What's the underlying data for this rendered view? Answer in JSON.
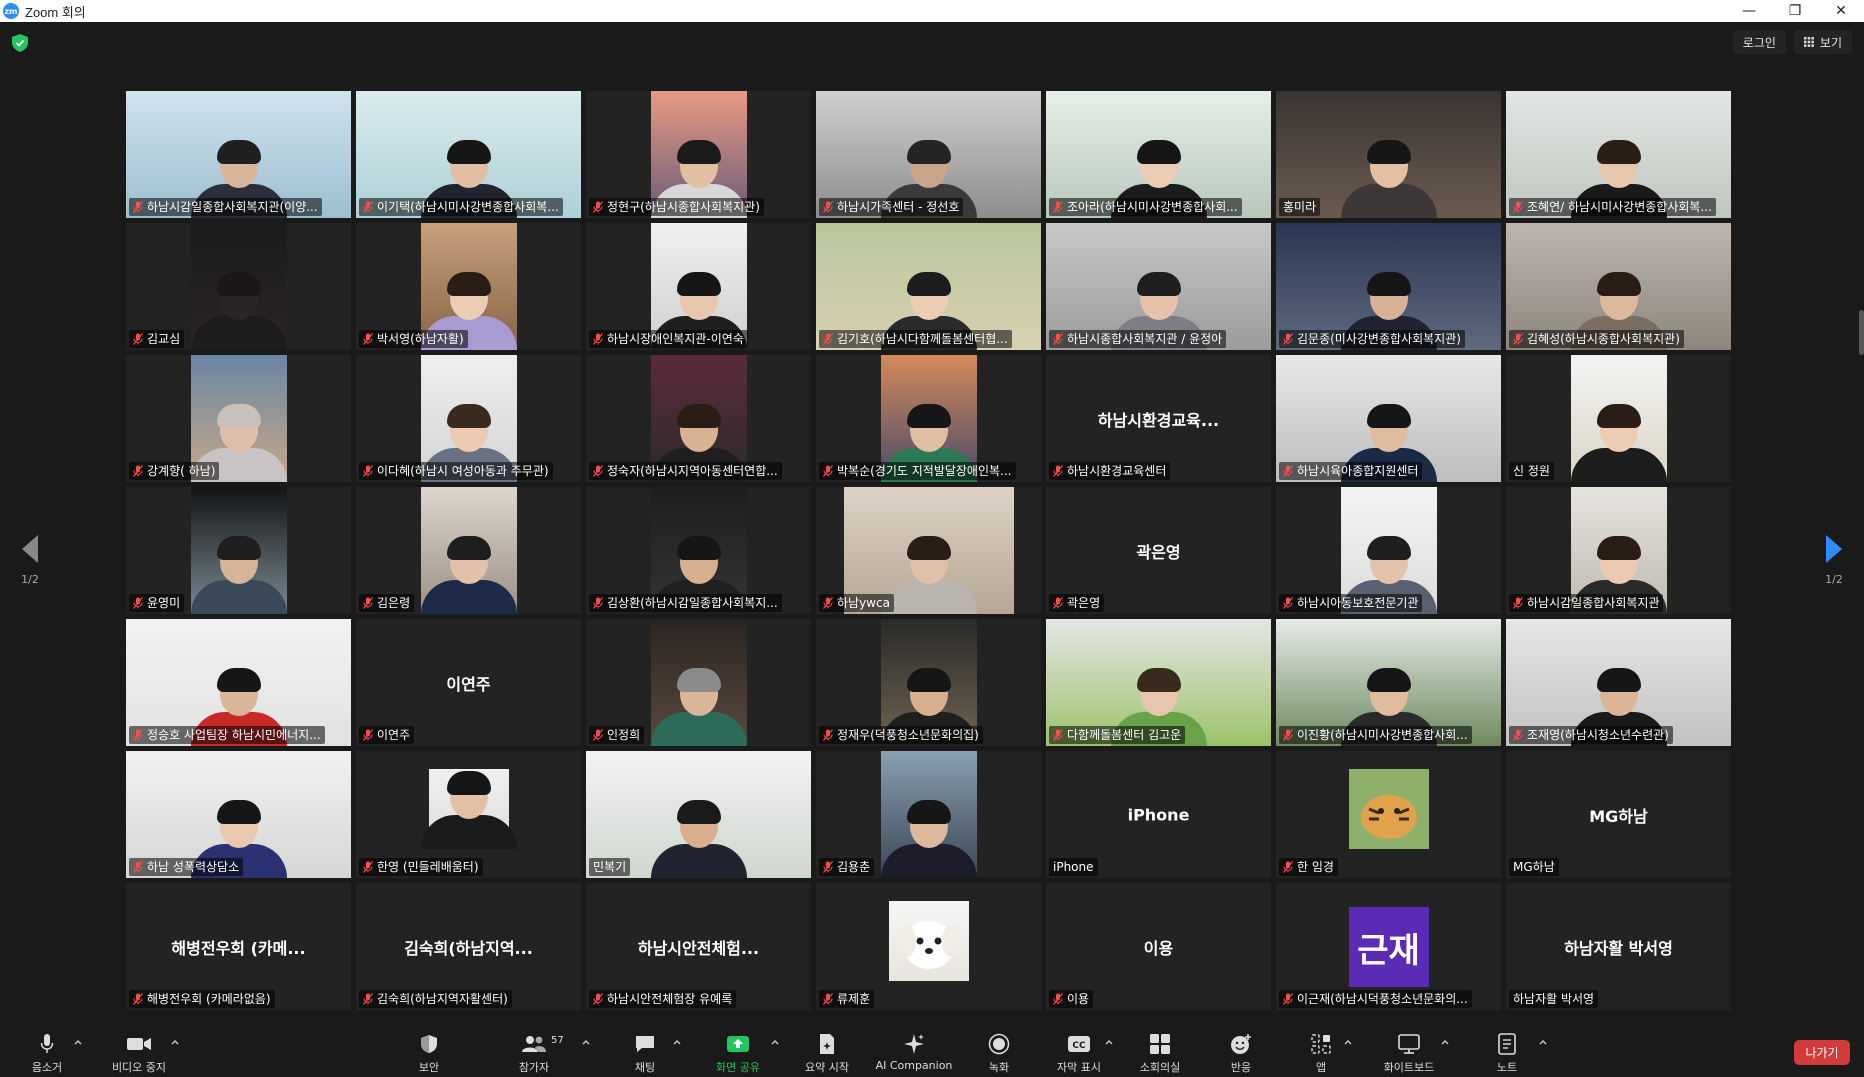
{
  "window": {
    "title": "Zoom 회의",
    "logo": "zm",
    "minimize": "—",
    "restore": "❐",
    "close": "✕"
  },
  "topbar": {
    "login": "로그인",
    "view": "보기"
  },
  "pager": {
    "left": "1/2",
    "right": "1/2"
  },
  "participants": [
    {
      "label": "하남시감일종합사회복지관(이양...",
      "muted": true,
      "video": "full",
      "c1": "#cfe3ee",
      "c2": "#9dbfcf",
      "skin": "#d9b59a",
      "hair": "#1f1f1f",
      "shirt": "#2a2f3a"
    },
    {
      "label": "이기택(하남시미사강변종합사회복...",
      "muted": true,
      "active": true,
      "video": "full",
      "c1": "#d8ecef",
      "c2": "#aed0d6",
      "skin": "#e0bea3",
      "hair": "#161616",
      "shirt": "#20242c"
    },
    {
      "label": "정현구(하남시종합사회복지관)",
      "muted": true,
      "video": "center",
      "c1": "#e89a83",
      "c2": "#6a5a78",
      "skin": "#e3bfa1",
      "hair": "#1a1a1a",
      "shirt": "#d8d8d8"
    },
    {
      "label": "하남시가족센터 - 정선호",
      "muted": true,
      "video": "full",
      "c1": "#cfcfcf",
      "c2": "#8d8d8d",
      "skin": "#c9a58c",
      "hair": "#242424",
      "shirt": "#3a3a3a"
    },
    {
      "label": "조아라(하남시미사강변종합사회...",
      "muted": true,
      "video": "full",
      "c1": "#e6efe8",
      "c2": "#b8c7bb",
      "skin": "#ebcdb5",
      "hair": "#161616",
      "shirt": "#1c1c1c"
    },
    {
      "label": "홍미라",
      "muted": false,
      "video": "full",
      "c1": "#3a3431",
      "c2": "#6a5b50",
      "skin": "#e3c0a4",
      "hair": "#161616",
      "shirt": "#3d3837"
    },
    {
      "label": "조혜연/ 하남시미사강변종합사회복...",
      "muted": true,
      "video": "full",
      "c1": "#e3e6e3",
      "c2": "#bfc6c0",
      "skin": "#e6c7ae",
      "hair": "#2a1e17",
      "shirt": "#1a1a1a"
    },
    {
      "label": "김교심",
      "muted": true,
      "video": "center",
      "c1": "#1c1a1b",
      "c2": "#2a2627",
      "skin": "#2b2525",
      "hair": "#1b1717",
      "shirt": "#1e1b1b"
    },
    {
      "label": "박서영(하남자활)",
      "muted": true,
      "video": "center",
      "c1": "#c9a07b",
      "c2": "#866446",
      "skin": "#ecccb5",
      "hair": "#2a1d15",
      "shirt": "#a99ad2"
    },
    {
      "label": "하남시장애인복지관-이연숙",
      "muted": true,
      "video": "center",
      "c1": "#f0f0f0",
      "c2": "#cfcfcf",
      "skin": "#e7c6ad",
      "hair": "#161616",
      "shirt": "#1f1f1f"
    },
    {
      "label": "김기호(하남시다함께돌봄센터협...",
      "muted": true,
      "video": "full",
      "c1": "#b9c79c",
      "c2": "#d8d0b2",
      "skin": "#ecccb3",
      "hair": "#1d1d1d",
      "shirt": "#2a2a2a"
    },
    {
      "label": "하남시종합사회복지관 / 윤정아",
      "muted": true,
      "video": "full",
      "c1": "#c8c8c8",
      "c2": "#9b9b9b",
      "skin": "#e4c3aa",
      "hair": "#1f1f1f",
      "shirt": "#7e7e86"
    },
    {
      "label": "김문종(미사강변종합사회복지관)",
      "muted": true,
      "video": "full",
      "c1": "#2a3552",
      "c2": "#5f6a7e",
      "skin": "#d8b196",
      "hair": "#161616",
      "shirt": "#1f2430"
    },
    {
      "label": "김혜성(하남시종합사회복지관)",
      "muted": true,
      "video": "full",
      "c1": "#bdb6ae",
      "c2": "#8e867d",
      "skin": "#dcb99d",
      "hair": "#2a1d15",
      "shirt": "#7a6e63"
    },
    {
      "label": "강계향( 하남)",
      "muted": true,
      "video": "center",
      "c1": "#6a86a6",
      "c2": "#c7a886",
      "skin": "#e0bfa8",
      "hair": "#c9c0bb",
      "shirt": "#c9c3c4"
    },
    {
      "label": "이다혜(하남시 여성아동과 주무관)",
      "muted": true,
      "video": "center",
      "c1": "#eeeeee",
      "c2": "#d4d4d4",
      "skin": "#ebcab1",
      "hair": "#3a2a1e",
      "shirt": "#6a7180"
    },
    {
      "label": "정숙자(하남시지역아동센터연합...",
      "muted": true,
      "video": "center",
      "c1": "#5a2b3a",
      "c2": "#2b2b2b",
      "skin": "#d9b294",
      "hair": "#2a1d15",
      "shirt": "#1f1f1f"
    },
    {
      "label": "박복순(경기도 지적발달장애인복...",
      "muted": true,
      "video": "center",
      "c1": "#d58a5a",
      "c2": "#4a4a6a",
      "skin": "#e0bea1",
      "hair": "#161616",
      "shirt": "#2c7a55"
    },
    {
      "label": "하남시환경교육센터",
      "muted": true,
      "video": "none",
      "display": "하남시환경교육..."
    },
    {
      "label": "하남시육아종합지원센터",
      "muted": true,
      "video": "full",
      "c1": "#e8e8e8",
      "c2": "#bdbdbd",
      "skin": "#e0bc9e",
      "hair": "#161616",
      "shirt": "#1b2a45"
    },
    {
      "label": "신 정원",
      "muted": false,
      "video": "center",
      "c1": "#f4f4f4",
      "c2": "#dad4c5",
      "skin": "#ecccb3",
      "hair": "#2a1d15",
      "shirt": "#1d1d1d"
    },
    {
      "label": "윤영미",
      "muted": true,
      "video": "center",
      "c1": "#141414",
      "c2": "#7a8a94",
      "skin": "#d7b499",
      "hair": "#1f1f1f",
      "shirt": "#3a4a5a"
    },
    {
      "label": "김은령",
      "muted": true,
      "video": "center",
      "c1": "#ddd6ce",
      "c2": "#9b8f82",
      "skin": "#e2c1a8",
      "hair": "#1e1e1e",
      "shirt": "#1e2a4a"
    },
    {
      "label": "김상환(하남시감일종합사회복지...",
      "muted": true,
      "video": "center",
      "c1": "#1e1e1e",
      "c2": "#343434",
      "skin": "#d8b090",
      "hair": "#161616",
      "shirt": "#202020"
    },
    {
      "label": "하남ywca",
      "muted": true,
      "video": "wide",
      "c1": "#ddd2c4",
      "c2": "#b6a794",
      "skin": "#e0c0a6",
      "hair": "#2a1d15",
      "shirt": "#b9b5ae"
    },
    {
      "label": "곽은영",
      "muted": true,
      "video": "none",
      "display": "곽은영"
    },
    {
      "label": "하남시아동보호전문기관",
      "muted": true,
      "video": "center",
      "c1": "#f4f4f4",
      "c2": "#dcdcdc",
      "skin": "#e4c3aa",
      "hair": "#1f1f1f",
      "shirt": "#5a6070"
    },
    {
      "label": "하남시감일종합사회복지관",
      "muted": true,
      "video": "center",
      "c1": "#e6e4df",
      "c2": "#bfbab0",
      "skin": "#ebcab1",
      "hair": "#2a1d15",
      "shirt": "#2a2a2a"
    },
    {
      "label": "정승호 사업팀장 하남시민에너지...",
      "muted": true,
      "video": "full",
      "c1": "#f2f2f2",
      "c2": "#e2e2e2",
      "skin": "#dbb597",
      "hair": "#161616",
      "shirt": "#c82a2a"
    },
    {
      "label": "이연주",
      "muted": true,
      "video": "none",
      "display": "이연주"
    },
    {
      "label": "인정희",
      "muted": true,
      "video": "center",
      "c1": "#2a2420",
      "c2": "#5a4a3e",
      "skin": "#dbb597",
      "hair": "#8a8a8a",
      "shirt": "#2c6a5a"
    },
    {
      "label": "정재우(덕풍청소년문화의집)",
      "muted": true,
      "video": "center",
      "c1": "#2a2a2a",
      "c2": "#6e6450",
      "skin": "#d8b090",
      "hair": "#161616",
      "shirt": "#1f1f1f"
    },
    {
      "label": "다함께돌봄센터 김고운",
      "muted": true,
      "video": "full",
      "c1": "#e6e6e6",
      "c2": "#9cc36a",
      "skin": "#e7c6ad",
      "hair": "#3a2a1e",
      "shirt": "#6aa24a"
    },
    {
      "label": "이진황(하남시미사강변종합사회...",
      "muted": true,
      "video": "full",
      "c1": "#e5ebe6",
      "c2": "#6e8a5e",
      "skin": "#e0bc9e",
      "hair": "#161616",
      "shirt": "#2a2a2a"
    },
    {
      "label": "조재영(하남시청소년수련관)",
      "muted": true,
      "video": "full",
      "c1": "#e6e6e6",
      "c2": "#c2c2c2",
      "skin": "#dbb597",
      "hair": "#161616",
      "shirt": "#1a1a1a"
    },
    {
      "label": "하남 성폭력상담소",
      "muted": true,
      "video": "full",
      "c1": "#f1f1f1",
      "c2": "#d6d6d6",
      "skin": "#e8c8ae",
      "hair": "#161616",
      "shirt": "#2a3070"
    },
    {
      "label": "한영 (민들레배움터)",
      "muted": true,
      "video": "center-sm",
      "c1": "#f0f0f0",
      "c2": "#dcdcdc",
      "skin": "#e2c0a6",
      "hair": "#161616",
      "shirt": "#1a1a1a"
    },
    {
      "label": "민복기",
      "muted": false,
      "video": "full",
      "c1": "#f2f2f2",
      "c2": "#cfd6cf",
      "skin": "#d8b090",
      "hair": "#1a1a1a",
      "shirt": "#1f2430"
    },
    {
      "label": "김용춘",
      "muted": true,
      "video": "center",
      "c1": "#8aa0b2",
      "c2": "#3a4654",
      "skin": "#dcb99d",
      "hair": "#161616",
      "shirt": "#1c1c2a"
    },
    {
      "label": "iPhone",
      "muted": false,
      "video": "none",
      "display": "iPhone"
    },
    {
      "label": "한 임경",
      "muted": true,
      "video": "avatar-img",
      "c1": "#8fb06a",
      "c2": "#e0a24a"
    },
    {
      "label": "MG하남",
      "muted": false,
      "video": "none",
      "display": "MG하남"
    },
    {
      "label": "해병전우회 (카메라없음)",
      "muted": true,
      "video": "none",
      "display": "해병전우회 (카메..."
    },
    {
      "label": "김숙희(하남지역자활센터)",
      "muted": true,
      "video": "none",
      "display": "김숙희(하남지역..."
    },
    {
      "label": "하남시안전체험장 유예록",
      "muted": true,
      "video": "none",
      "display": "하남시안전체험..."
    },
    {
      "label": "류제훈",
      "muted": true,
      "video": "avatar-dog",
      "c1": "#f6f6f6",
      "c2": "#e8e4de"
    },
    {
      "label": "이용",
      "muted": true,
      "video": "none",
      "display": "이용"
    },
    {
      "label": "이근재(하남시덕풍청소년문화의...",
      "muted": true,
      "video": "avatar-text",
      "avatar_text": "근재",
      "avatar_color": "#5b2bb5"
    },
    {
      "label": "하남자활 박서영",
      "muted": false,
      "video": "none",
      "display": "하남자활 박서영"
    }
  ],
  "toolbar": {
    "audio": "음소거",
    "video": "비디오 중지",
    "security": "보안",
    "participants": "참가자",
    "participants_count": "57",
    "chat": "채팅",
    "share": "화면 공유",
    "summary": "요약 시작",
    "ai": "AI Companion",
    "record": "녹화",
    "captions": "자막 표시",
    "captions_icon": "CC",
    "breakout": "소회의실",
    "reactions": "반응",
    "apps": "앱",
    "whiteboard": "화이트보드",
    "notes": "노트",
    "leave": "나가기"
  },
  "colors": {
    "share_green": "#22c55e",
    "leave_red": "#d13b3b",
    "active_border": "#e5e16a",
    "pager_blue": "#2d8cff"
  }
}
